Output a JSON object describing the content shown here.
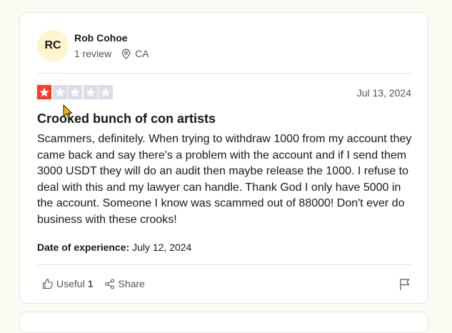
{
  "reviewer": {
    "initials": "RC",
    "name": "Rob Cohoe",
    "review_count": "1 review",
    "country": "CA"
  },
  "rating": {
    "stars": 1,
    "max": 5,
    "filled_color": "#ff3722",
    "empty_color": "#dcdce6"
  },
  "review": {
    "date": "Jul 13, 2024",
    "title": "Crooked bunch of con artists",
    "body": "Scammers, definitely. When trying to withdraw 1000 from my account they came back and say there's a problem with the account and if I send them 3000 USDT they will do an audit then maybe release the 1000. I refuse to deal with this and my lawyer can handle. Thank God I only have 5000 in the account. Someone I know was scammed out of 88000! Don't ever do business with these crooks!",
    "experience_label": "Date of experience:",
    "experience_date": "July 12, 2024"
  },
  "actions": {
    "useful_label": "Useful",
    "useful_count": "1",
    "share_label": "Share"
  },
  "icons": {
    "location": "location-pin-icon",
    "useful": "thumbs-up-icon",
    "share": "share-icon",
    "flag": "flag-icon",
    "cursor": "mouse-cursor-icon"
  }
}
